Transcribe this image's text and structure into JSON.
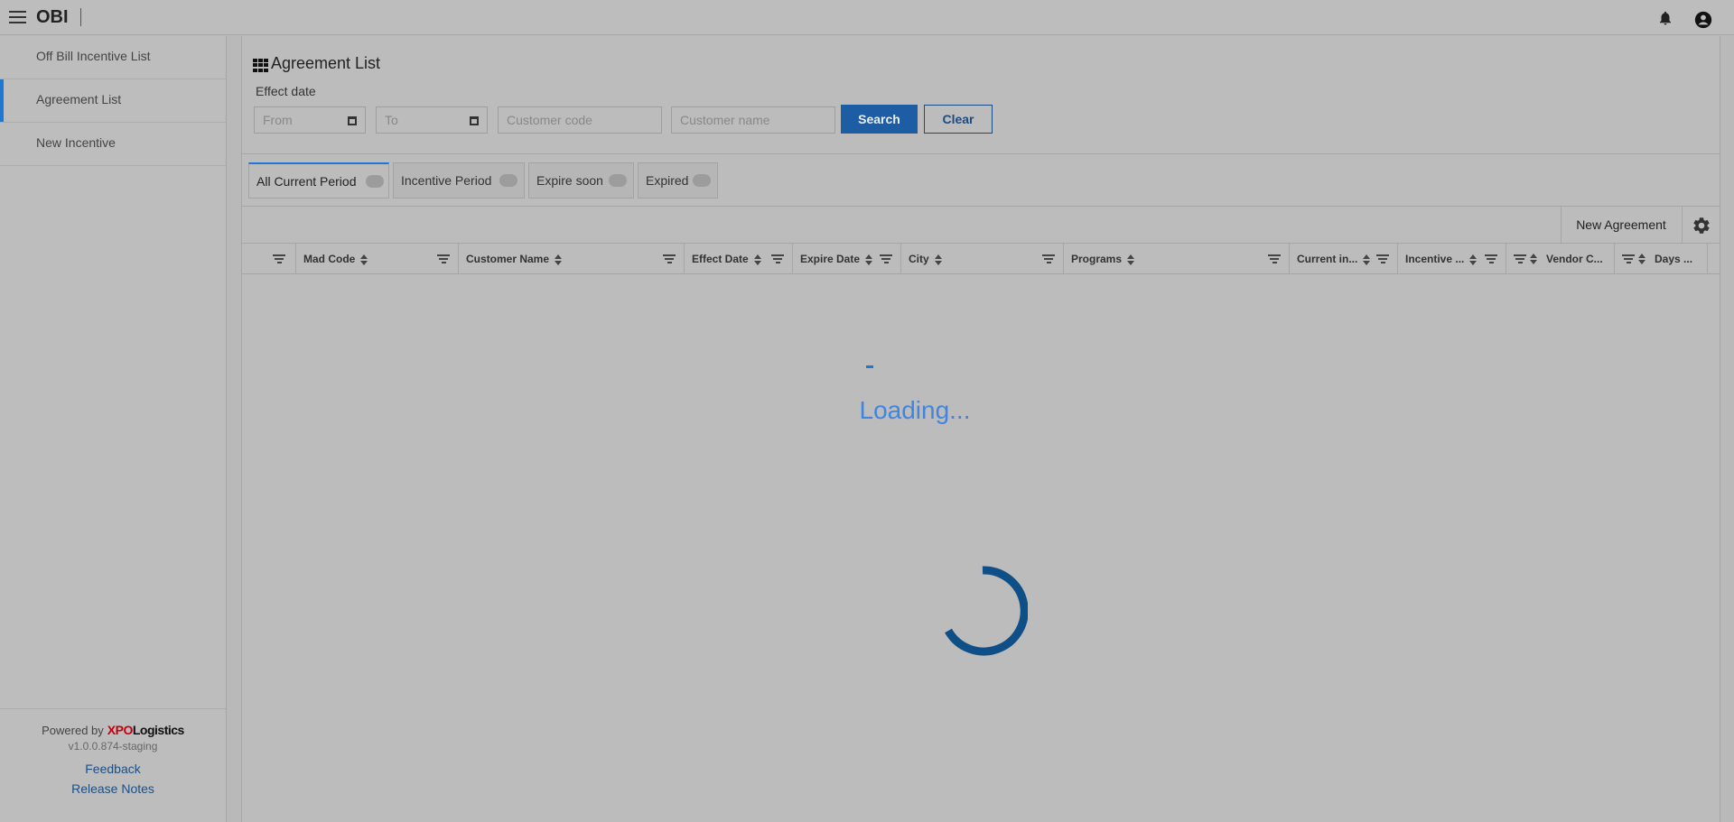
{
  "app": {
    "title": "OBI"
  },
  "sidebar": {
    "items": [
      {
        "label": "Off Bill Incentive List",
        "active": false
      },
      {
        "label": "Agreement List",
        "active": true
      },
      {
        "label": "New Incentive",
        "active": false
      }
    ],
    "footer": {
      "powered_by": "Powered by",
      "brand_xpo": "XPO",
      "brand_logistics": "Logistics",
      "version": "v1.0.0.874-staging",
      "feedback": "Feedback",
      "release_notes": "Release Notes"
    }
  },
  "filters": {
    "page_title": "Agreement List",
    "effect_date_label": "Effect date",
    "from_placeholder": "From",
    "to_placeholder": "To",
    "customer_code_placeholder": "Customer code",
    "customer_name_placeholder": "Customer name",
    "search_label": "Search",
    "clear_label": "Clear"
  },
  "tabs": [
    {
      "label": "All Current Period",
      "active": true
    },
    {
      "label": "Incentive Period",
      "active": false
    },
    {
      "label": "Expire soon",
      "active": false
    },
    {
      "label": "Expired",
      "active": false
    }
  ],
  "toolbar": {
    "new_agreement_label": "New Agreement"
  },
  "table": {
    "columns": [
      {
        "label": ""
      },
      {
        "label": "Mad Code"
      },
      {
        "label": "Customer Name"
      },
      {
        "label": "Effect Date"
      },
      {
        "label": "Expire Date"
      },
      {
        "label": "City"
      },
      {
        "label": "Programs"
      },
      {
        "label": "Current in..."
      },
      {
        "label": "Incentive ..."
      },
      {
        "label": "Vendor C..."
      },
      {
        "label": "Days ..."
      }
    ]
  },
  "loading": {
    "text": "Loading..."
  },
  "colors": {
    "accent": "#1e78d2",
    "primary_button": "#1d5da3",
    "loading_text": "#3f86e0",
    "spinner": "#0f4f87",
    "brand_red": "#c4000b"
  },
  "icons": {
    "menu": "hamburger-icon",
    "notifications": "bell-icon",
    "account": "account-circle-icon",
    "grid": "grid-icon",
    "calendar": "calendar-icon",
    "settings": "gear-icon",
    "sort": "sort-icon",
    "filter": "filter-icon"
  }
}
